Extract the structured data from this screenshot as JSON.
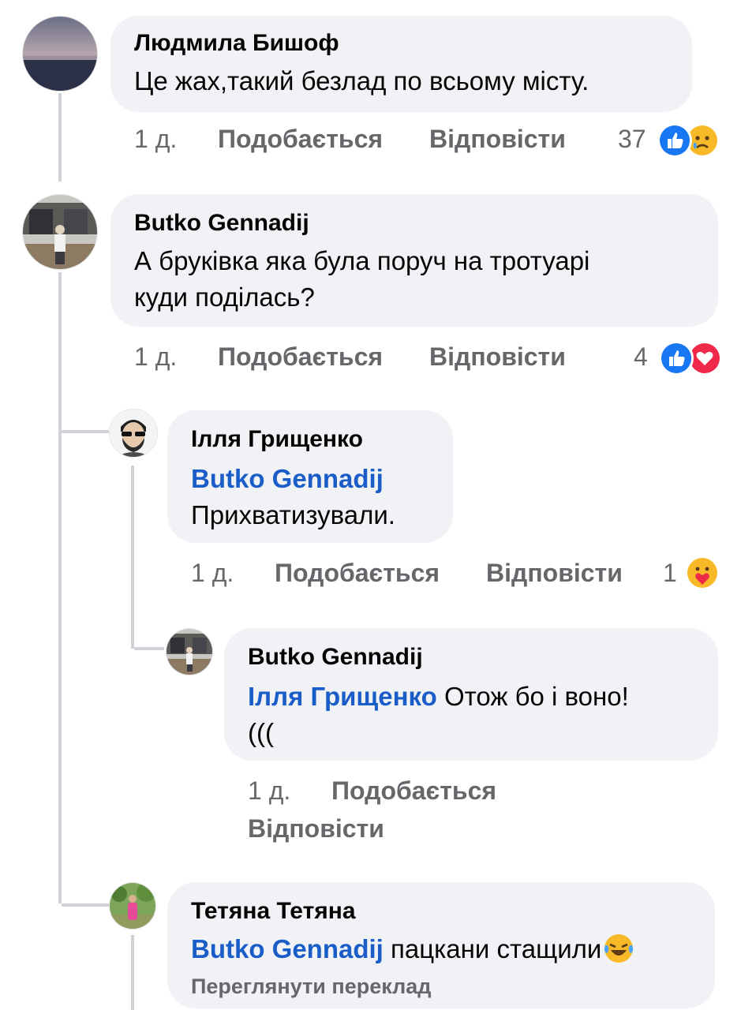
{
  "comments": [
    {
      "author": "Людмила Бишоф",
      "text": "Це жах,такий безлад по всьому місту.",
      "time": "1 д.",
      "like": "Подобається",
      "reply": "Відповісти",
      "reaction_count": "37",
      "reactions": [
        "like-icon",
        "sad-icon"
      ]
    },
    {
      "author": "Butko Gennadij",
      "text_line1": "А бруківка яка була поруч на тротуарі",
      "text_line2": "куди поділась?",
      "time": "1 д.",
      "like": "Подобається",
      "reply": "Відповісти",
      "reaction_count": "4",
      "reactions": [
        "like-icon",
        "love-icon"
      ]
    },
    {
      "author": "Ілля Грищенко",
      "mention": "Butko Gennadij",
      "text": "Прихватизували.",
      "time": "1 д.",
      "like": "Подобається",
      "reply": "Відповісти",
      "reaction_count": "1",
      "reactions": [
        "care-icon"
      ]
    },
    {
      "author": "Butko Gennadij",
      "mention": "Ілля Грищенко",
      "text_line1": " Отож бо і воно!",
      "text_line2": "(((",
      "time": "1 д.",
      "like": "Подобається",
      "reply": "Відповісти"
    },
    {
      "author": "Тетяна Тетяна",
      "mention": "Butko Gennadij",
      "text": " пацкани стащили",
      "emoji": "laughing-crying-icon",
      "translate": "Переглянути переклад"
    }
  ],
  "colors": {
    "bubble": "#f0f2f5",
    "mention": "#1a5dc8",
    "meta": "#65676b",
    "like_blue": "#1877f2",
    "love_red": "#f02849",
    "haha_yellow": "#f7b928"
  }
}
